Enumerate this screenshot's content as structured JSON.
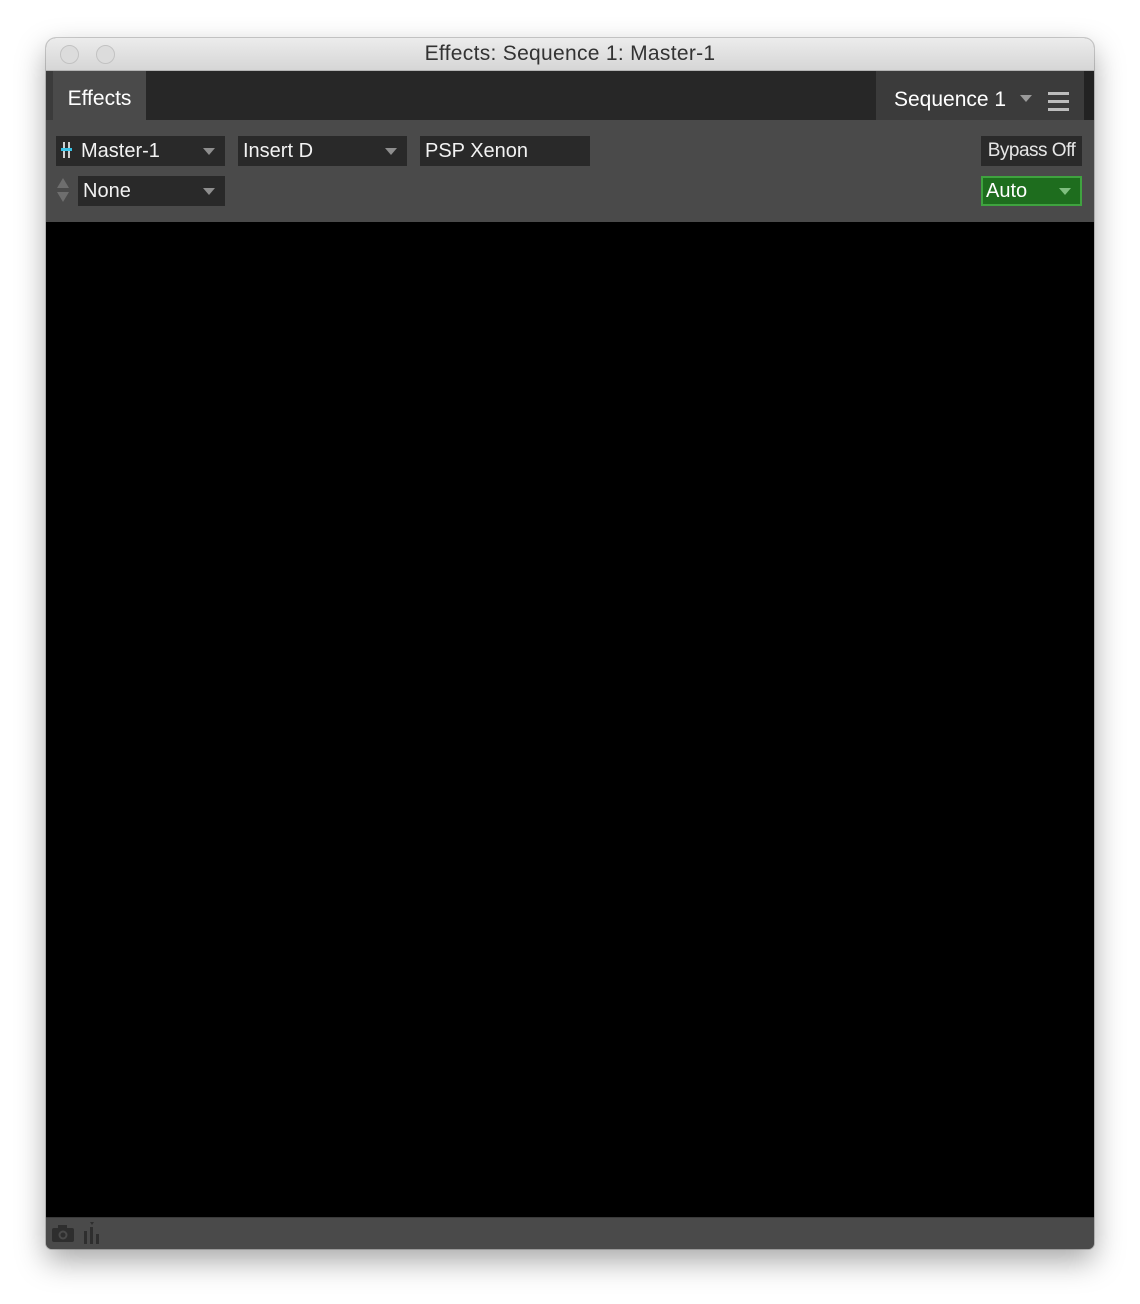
{
  "window": {
    "title": "Effects: Sequence 1: Master-1"
  },
  "tabs": {
    "effects_label": "Effects",
    "sequence_label": "Sequence 1"
  },
  "toolbar": {
    "track_select": "Master-1",
    "insert_select": "Insert D",
    "plugin_name": "PSP Xenon",
    "preset_select": "None",
    "bypass_label": "Bypass Off",
    "automation_select": "Auto"
  },
  "colors": {
    "automation_active": "#1e6d1e",
    "track_icon_accent": "#39c2e6"
  },
  "icons": {
    "menu": "hamburger-menu-icon",
    "status_left": "camera-icon",
    "status_right": "meter-bars-icon"
  }
}
